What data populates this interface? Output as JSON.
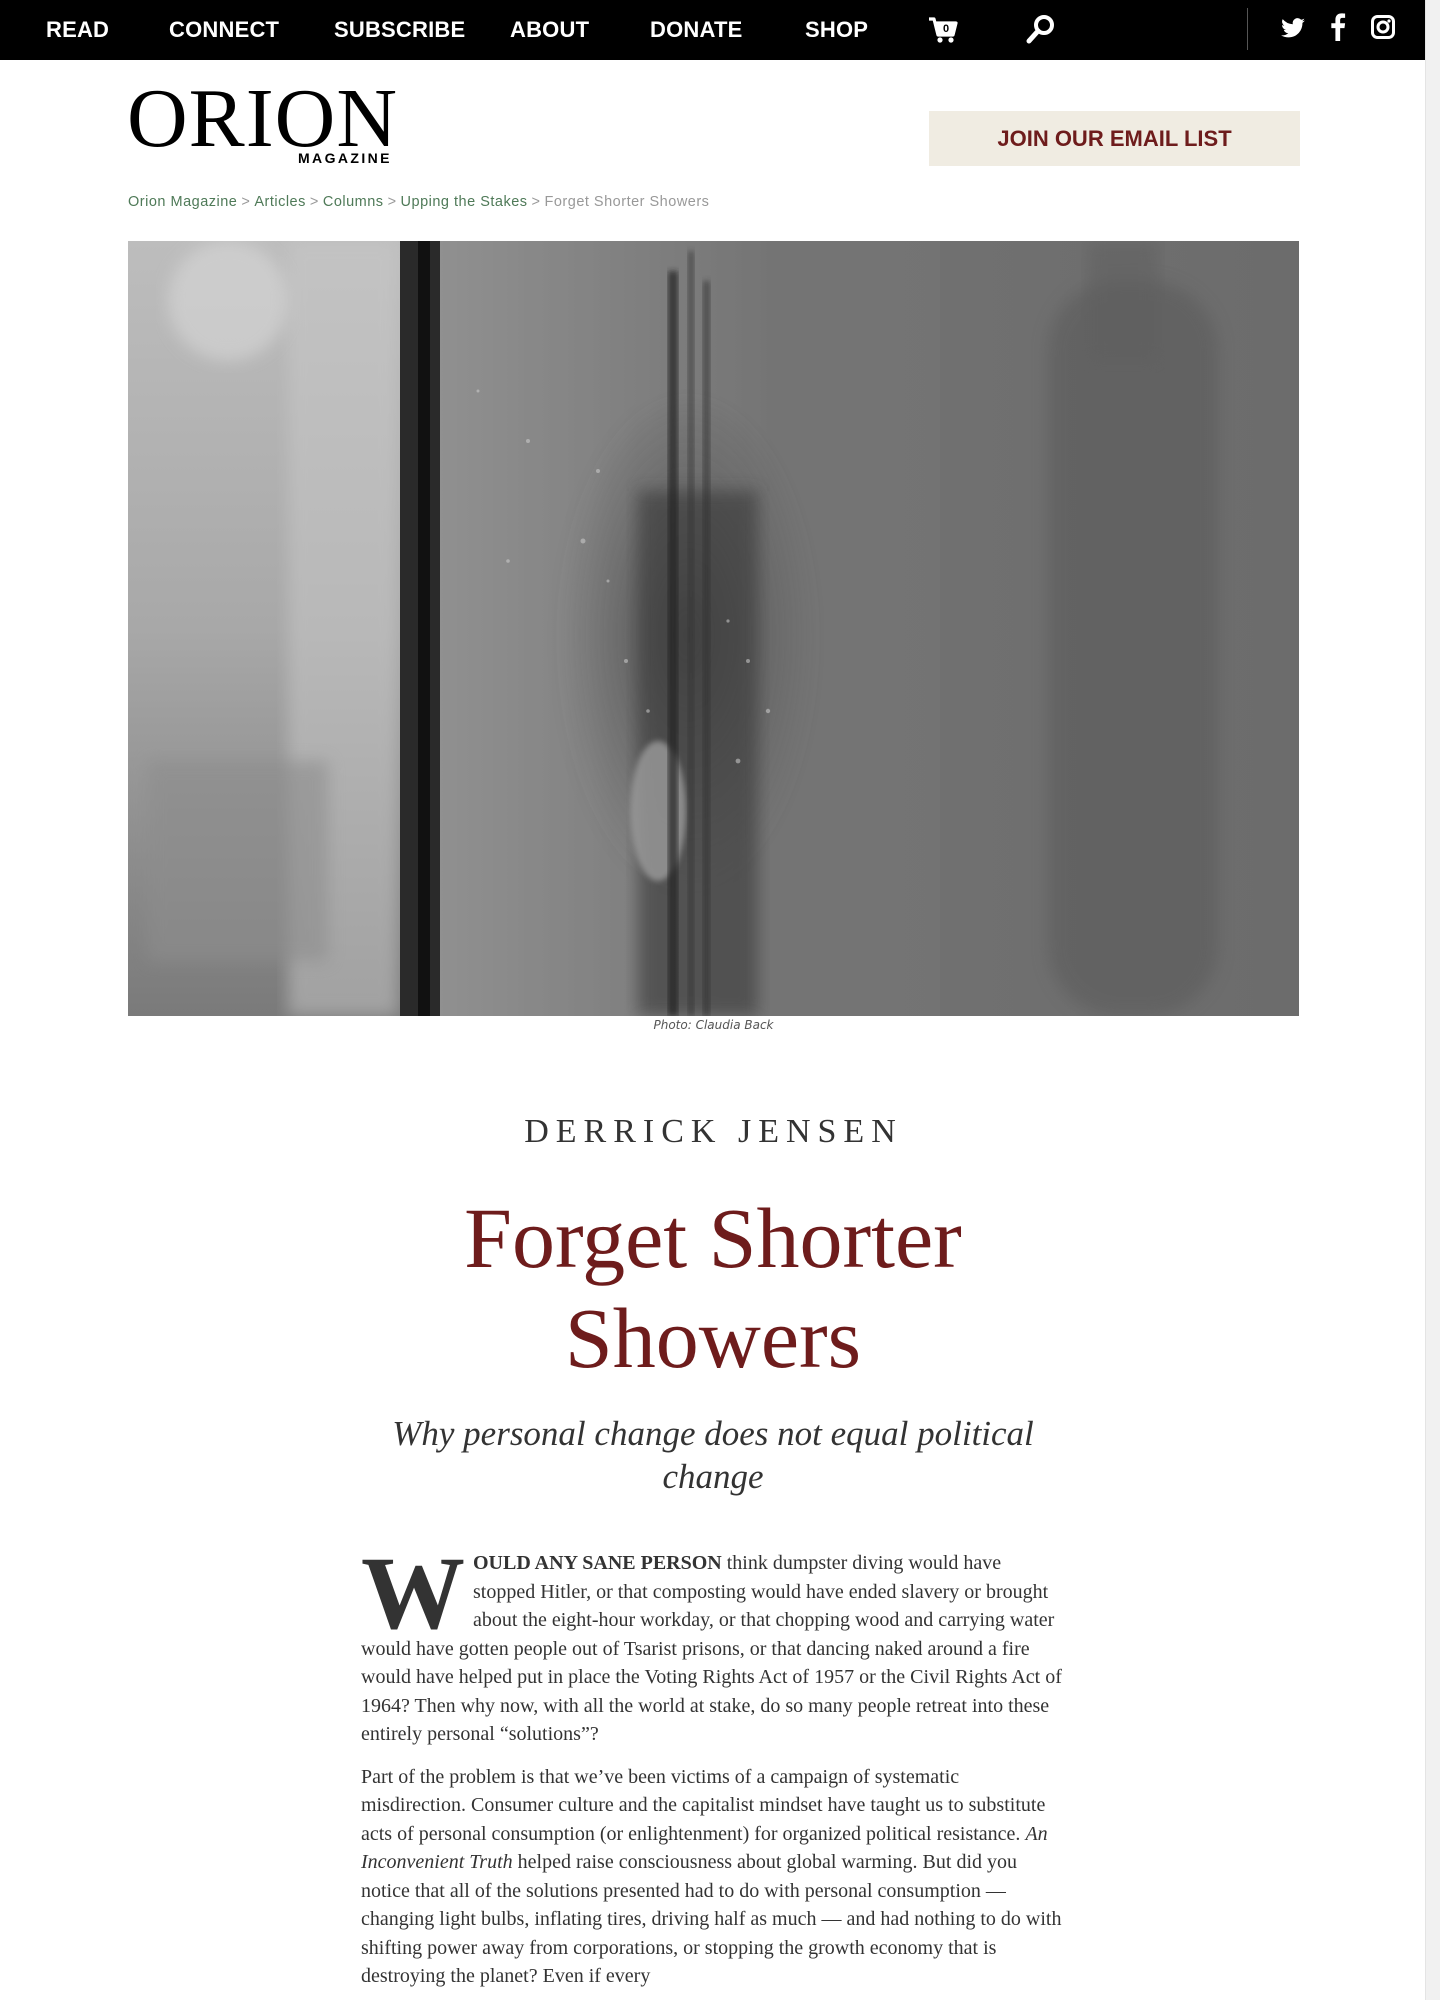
{
  "nav": {
    "items": [
      "READ",
      "CONNECT",
      "SUBSCRIBE",
      "ABOUT",
      "DONATE",
      "SHOP"
    ],
    "cart_count": "0",
    "icons": [
      "cart-icon",
      "search-icon",
      "twitter-icon",
      "facebook-icon",
      "instagram-icon"
    ]
  },
  "header": {
    "logo_main": "ORION",
    "logo_sub": "MAGAZINE",
    "email_button": "JOIN OUR EMAIL LIST"
  },
  "breadcrumb": {
    "links": [
      "Orion Magazine",
      "Articles",
      "Columns",
      "Upping the Stakes"
    ],
    "current": "Forget Shorter Showers",
    "separator": ">"
  },
  "hero": {
    "caption": "Photo: Claudia Back"
  },
  "article": {
    "author": "DERRICK JENSEN",
    "title": "Forget Shorter Showers",
    "subtitle": "Why personal change does not equal political change",
    "dropcap": "W",
    "lead_caps": "OULD ANY SANE PERSON",
    "p1_rest": " think dumpster diving would have stopped Hitler, or that composting would have ended slavery or brought about the eight-hour workday, or that chopping wood and carrying water would have gotten people out of Tsarist prisons, or that dancing naked around a fire would have helped put in place the Voting Rights Act of 1957 or the Civil Rights Act of 1964? Then why now, with all the world at stake, do so many people retreat into these entirely personal “solutions”?",
    "p2_a": "Part of the problem is that we’ve been victims of a campaign of systematic misdirection. Consumer culture and the capitalist mindset have taught us to substitute acts of personal consumption (or enlightenment) for organized political resistance. ",
    "p2_italic": "An Inconvenient Truth",
    "p2_b": " helped raise consciousness about global warming. But did you notice that all of the solutions presented had to do with personal consumption — changing light bulbs, inflating tires, driving half as much — and had nothing to do with shifting power away from corporations, or stopping the growth economy that is destroying the planet? Even if every"
  },
  "colors": {
    "nav_bg": "#000000",
    "title": "#6e1c1c",
    "breadcrumb_link": "#4f7a58",
    "email_button_bg": "#f0ece2"
  }
}
